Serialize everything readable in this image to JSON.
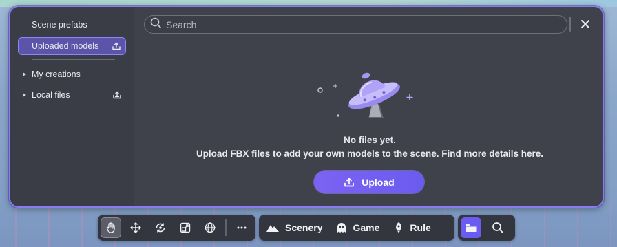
{
  "sidebar": {
    "items": [
      {
        "label": "Scene prefabs"
      },
      {
        "label": "Uploaded models"
      },
      {
        "label": "My creations"
      },
      {
        "label": "Local files"
      }
    ]
  },
  "search": {
    "placeholder": "Search"
  },
  "empty_state": {
    "title": "No files yet.",
    "desc_before": "Upload FBX files to add your own models to the scene. Find ",
    "desc_link": "more details",
    "desc_after": " here.",
    "upload_label": "Upload"
  },
  "toolbar": {
    "modes": [
      {
        "label": "Scenery"
      },
      {
        "label": "Game"
      },
      {
        "label": "Rule"
      }
    ]
  },
  "colors": {
    "accent": "#6a5cf0",
    "panel_border": "#8b7bf0",
    "panel_bg": "#3f414b"
  }
}
